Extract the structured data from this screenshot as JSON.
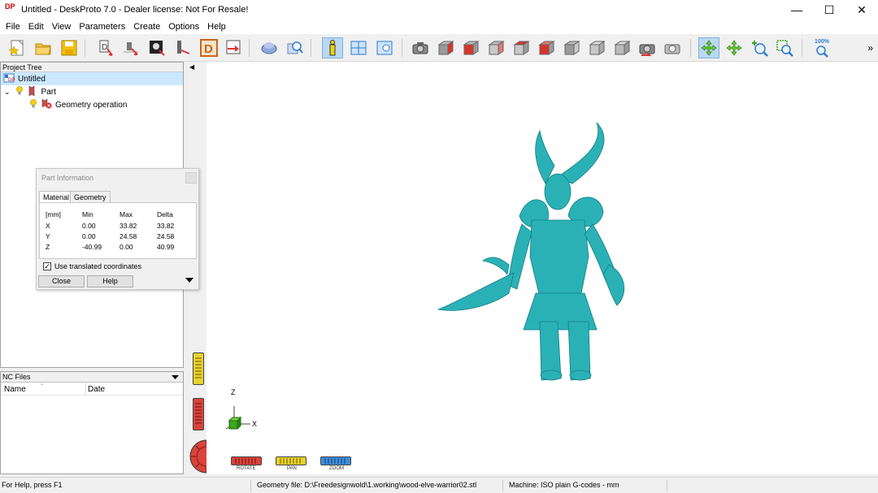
{
  "window": {
    "app_icon": "DP",
    "title": "Untitled - DeskProto 7.0 - Dealer license: Not For Resale!",
    "controls": {
      "minimize": "—",
      "maximize": "☐",
      "close": "✕"
    }
  },
  "menu": {
    "items": [
      "File",
      "Edit",
      "View",
      "Parameters",
      "Create",
      "Options",
      "Help"
    ]
  },
  "toolbar": {
    "zoom_level": "100%",
    "overflow": "»",
    "accent": "#2e7ad0",
    "icons": [
      "new-file-icon",
      "open-folder-icon",
      "save-icon",
      "wizard-3d-icon",
      "wizard-2d-icon",
      "wizard-image-icon",
      "wizard-rotary-icon",
      "wizard-d-icon",
      "import-export-icon",
      "shaded-view-icon",
      "search-zoom-icon",
      "info-icon",
      "layout-icon",
      "preview-icon",
      "camera-view-icon",
      "view-front-icon",
      "view-back-icon",
      "view-left-icon",
      "view-right-icon",
      "view-top-icon",
      "view-bottom-icon",
      "view-iso-icon",
      "view-iso2-icon",
      "previous-view-icon",
      "fit-view-icon",
      "rotate-mode-icon",
      "pan-mode-icon",
      "zoom-in-icon",
      "zoom-window-icon",
      "zoom-100-icon"
    ]
  },
  "project_tree": {
    "header": "Project Tree",
    "root": "Untitled",
    "part": "Part",
    "operation": "Geometry operation"
  },
  "part_info": {
    "title": "Part Information",
    "tabs": [
      "Material",
      "Geometry"
    ],
    "headers": [
      "[mm]",
      "Min",
      "Max",
      "Delta"
    ],
    "rows": [
      {
        "axis": "X",
        "min": "0.00",
        "max": "33.82",
        "delta": "33.82"
      },
      {
        "axis": "Y",
        "min": "0.00",
        "max": "24.58",
        "delta": "24.58"
      },
      {
        "axis": "Z",
        "min": "-40.99",
        "max": "0.00",
        "delta": "40.99"
      }
    ],
    "checkbox_label": "Use translated coordinates",
    "checkbox_checked": true,
    "close_button": "Close",
    "help_button": "Help"
  },
  "nc_files": {
    "header": "NC Files",
    "col_name": "Name",
    "col_date": "Date"
  },
  "viewport": {
    "model_color": "#2ab1b6",
    "axis_z": "Z",
    "axis_x": "X",
    "sliders": [
      {
        "label": "ROTATE",
        "color": "#d9433b"
      },
      {
        "label": "PAN",
        "color": "#e7d22e"
      },
      {
        "label": "ZOOM",
        "color": "#3f8ddb"
      }
    ]
  },
  "status": {
    "help_text": "For Help, press F1",
    "geometry_file": "Geometry file: D:\\Freedesignwold\\1.working\\wood-elve-warrior02.stl",
    "machine": "Machine: ISO plain G-codes - mm"
  }
}
